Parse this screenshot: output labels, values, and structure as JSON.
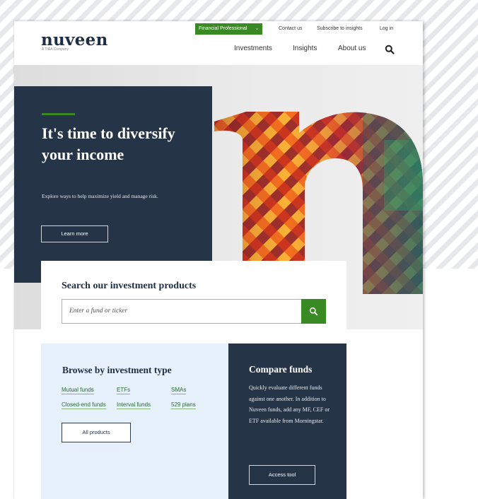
{
  "header": {
    "logo": "nuveen",
    "logo_sub": "A TIAA Company",
    "role_select": "Financial Professional",
    "utility_links": [
      "Contact us",
      "Subscribe to insights",
      "Log in"
    ],
    "nav_links": [
      "Investments",
      "Insights",
      "About us"
    ],
    "search_icon": "search-icon"
  },
  "hero": {
    "title": "It's time to diversify your income",
    "subtitle": "Explore ways to help maximize yield and manage risk.",
    "cta": "Learn more"
  },
  "search": {
    "title": "Search our investment products",
    "placeholder": "Enter a fund or ticker"
  },
  "browse": {
    "title": "Browse by investment type",
    "links": [
      "Mutual funds",
      "ETFs",
      "SMAs",
      "Closed-end funds",
      "Interval funds",
      "529 plans"
    ],
    "all_button": "All products"
  },
  "compare": {
    "title": "Compare funds",
    "description": "Quickly evaluate different funds against one another. In addition to Nuveen funds, add any MF, CEF or ETF available from Morningstar.",
    "button": "Access tool"
  },
  "colors": {
    "navy": "#263447",
    "green": "#3a8a24",
    "light_blue": "#e6f1fb"
  }
}
